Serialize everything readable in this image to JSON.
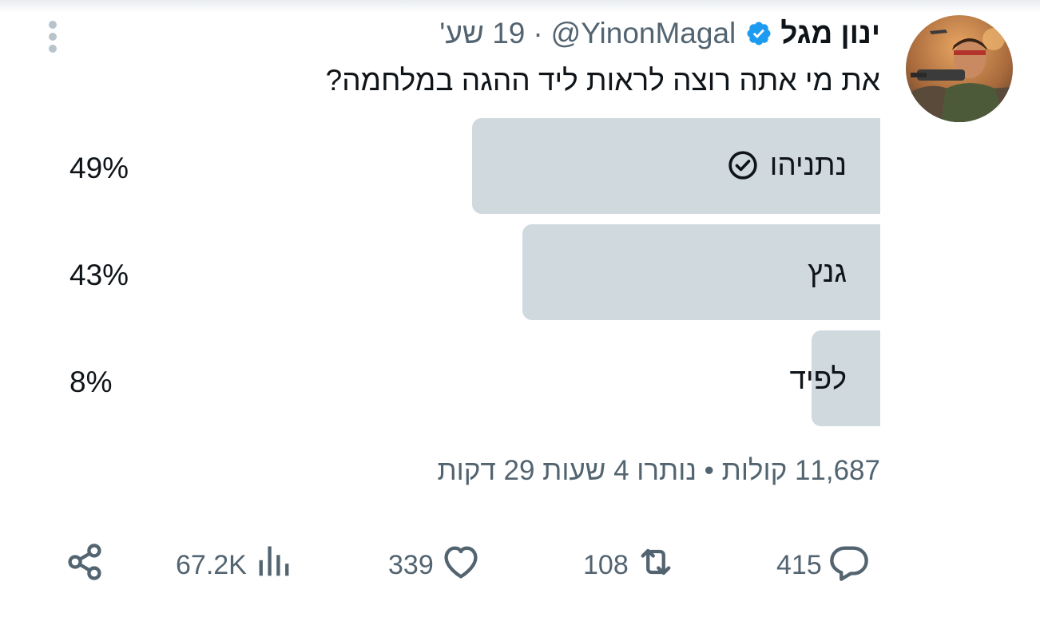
{
  "tweet": {
    "author_name": "ינון מגל",
    "handle": "@YinonMagal",
    "separator": "·",
    "time": "19 שע'",
    "text": "את מי אתה רוצה לראות ליד ההגה במלחמה?",
    "verified_color": "#1d9bf0"
  },
  "poll": {
    "options": [
      {
        "label": "נתניהו",
        "percent_label": "49%",
        "value": 49,
        "selected": true
      },
      {
        "label": "גנץ",
        "percent_label": "43%",
        "value": 43,
        "selected": false
      },
      {
        "label": "לפיד",
        "percent_label": "8%",
        "value": 8,
        "selected": false
      }
    ],
    "meta": "11,687 קולות • נותרו 4 שעות 29 דקות",
    "bar_color": "#cfd9de"
  },
  "actions": {
    "replies": "415",
    "retweets": "108",
    "likes": "339",
    "views": "67.2K"
  },
  "icons": [
    "more-icon",
    "verified-badge-icon",
    "check-circle-icon",
    "reply-icon",
    "retweet-icon",
    "like-icon",
    "views-icon",
    "share-icon"
  ]
}
